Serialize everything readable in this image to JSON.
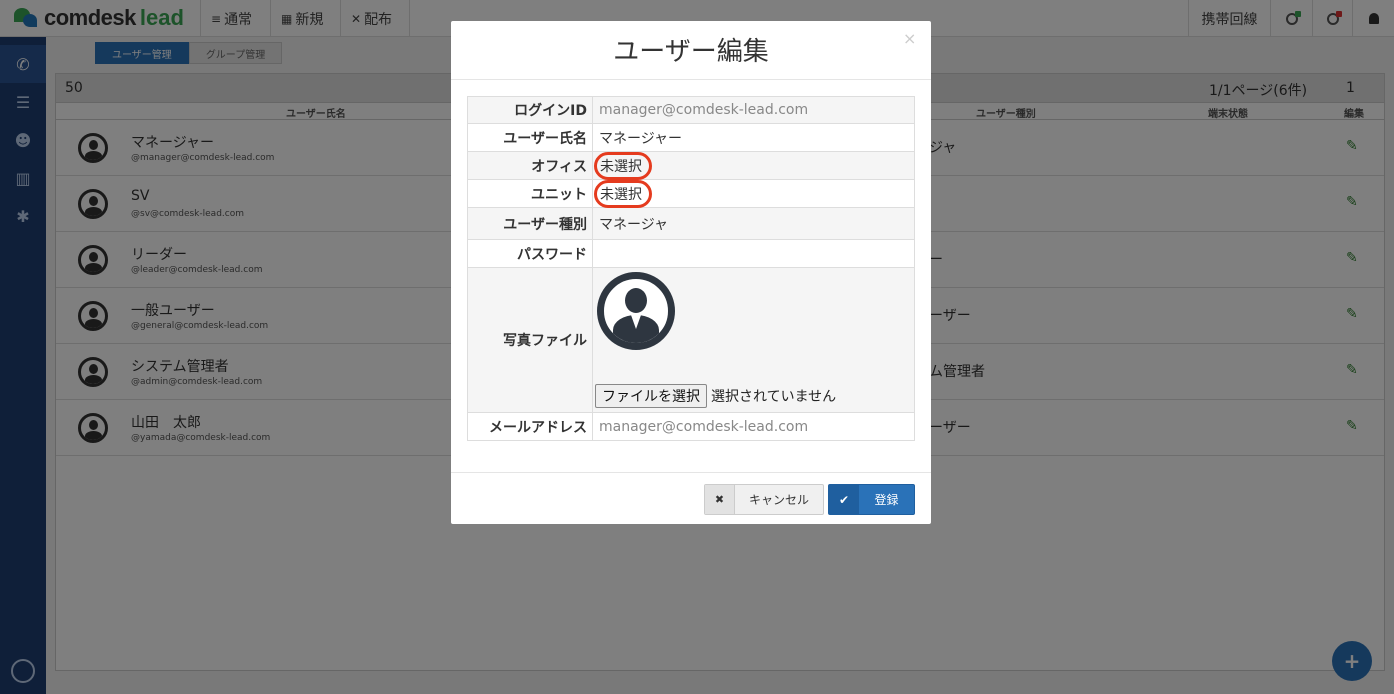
{
  "app": {
    "logo_text_1": "comdesk",
    "logo_text_2": "lead",
    "nav": [
      {
        "icon": "≡",
        "label": "通常"
      },
      {
        "icon": "▦",
        "label": "新規"
      },
      {
        "icon": "✕",
        "label": "配布"
      }
    ],
    "right_nav": {
      "line_label": "携帯回線"
    }
  },
  "tabs": [
    {
      "label": "ユーザー管理"
    },
    {
      "label": "グループ管理"
    }
  ],
  "list": {
    "count": "50",
    "pager": "1/1ページ(6件)",
    "page_number": "1",
    "columns": {
      "name": "ユーザー氏名",
      "type": "ユーザー種別",
      "device": "端末状態",
      "edit": "編集"
    },
    "rows": [
      {
        "name": "マネージャー",
        "mail": "@manager@comdesk-lead.com",
        "role": "ジャ"
      },
      {
        "name": "SV",
        "mail": "@sv@comdesk-lead.com",
        "role": ""
      },
      {
        "name": "リーダー",
        "mail": "@leader@comdesk-lead.com",
        "role": "ー"
      },
      {
        "name": "一般ユーザー",
        "mail": "@general@comdesk-lead.com",
        "role": "ーザー"
      },
      {
        "name": "システム管理者",
        "mail": "@admin@comdesk-lead.com",
        "role": "ム管理者"
      },
      {
        "name": "山田　太郎",
        "mail": "@yamada@comdesk-lead.com",
        "role": "ーザー"
      }
    ]
  },
  "modal": {
    "title": "ユーザー編集",
    "close": "×",
    "fields": {
      "login_label": "ログインID",
      "login_placeholder": "manager@comdesk-lead.com",
      "name_label": "ユーザー氏名",
      "name_value": "マネージャー",
      "office_label": "オフィス",
      "office_value": "未選択",
      "unit_label": "ユニット",
      "unit_value": "未選択",
      "type_label": "ユーザー種別",
      "type_value": "マネージャ",
      "password_label": "パスワード",
      "photo_label": "写真ファイル",
      "file_button": "ファイルを選択",
      "file_status": "選択されていません",
      "email_label": "メールアドレス",
      "email_placeholder": "manager@comdesk-lead.com"
    },
    "cancel_label": "キャンセル",
    "save_label": "登録"
  },
  "fab": "+",
  "colors": {
    "sidebar": "#1f3f73",
    "primary": "#2a72b8",
    "highlight": "#e53b1e",
    "edit": "#2e7d2e"
  }
}
